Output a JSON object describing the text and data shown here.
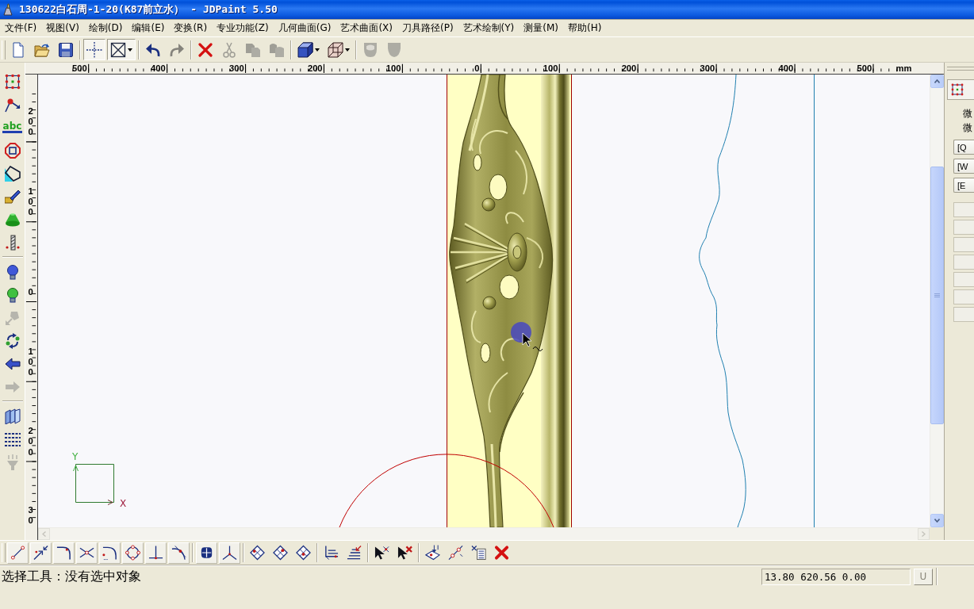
{
  "window": {
    "title": "130622白石周-1-20(K87前立水） - JDPaint 5.50"
  },
  "menu": [
    "文件(F)",
    "视图(V)",
    "绘制(D)",
    "编辑(E)",
    "变换(R)",
    "专业功能(Z)",
    "几何曲面(G)",
    "艺术曲面(X)",
    "刀具路径(P)",
    "艺术绘制(Y)",
    "测量(M)",
    "帮助(H)"
  ],
  "main_toolbar": [
    [
      {
        "kind": "button",
        "pressed": false,
        "disabled": false
      },
      {
        "kind": "button",
        "pressed": false,
        "disabled": false
      },
      {
        "kind": "button",
        "pressed": false,
        "disabled": false
      }
    ],
    [
      {
        "kind": "button",
        "pressed": true,
        "disabled": false
      },
      {
        "kind": "split",
        "pressed": true,
        "disabled": false
      }
    ],
    [
      {
        "kind": "button",
        "pressed": false,
        "disabled": false
      },
      {
        "kind": "button",
        "pressed": false,
        "disabled": true
      }
    ],
    [
      {
        "kind": "button",
        "pressed": false,
        "disabled": false
      },
      {
        "kind": "button",
        "pressed": false,
        "disabled": true
      },
      {
        "kind": "button",
        "pressed": false,
        "disabled": true
      },
      {
        "kind": "button",
        "pressed": false,
        "disabled": true
      }
    ],
    [
      {
        "kind": "split",
        "pressed": false,
        "disabled": false
      },
      {
        "kind": "split",
        "pressed": false,
        "disabled": false
      }
    ],
    [
      {
        "kind": "button",
        "pressed": false,
        "disabled": true
      },
      {
        "kind": "button",
        "pressed": false,
        "disabled": true
      }
    ]
  ],
  "left_toolbar": [
    [
      {
        "disabled": false
      },
      {
        "disabled": false
      },
      {
        "label": "abc",
        "disabled": false
      },
      {
        "disabled": false
      },
      {
        "disabled": false
      },
      {
        "disabled": false
      },
      {
        "disabled": false
      },
      {
        "disabled": false
      }
    ],
    [
      {
        "disabled": false
      },
      {
        "disabled": false
      },
      {
        "disabled": true
      },
      {
        "disabled": false
      },
      {
        "disabled": false
      },
      {
        "disabled": true
      }
    ],
    [
      {
        "disabled": false
      },
      {
        "disabled": false
      },
      {
        "disabled": true
      }
    ]
  ],
  "ruler_top": {
    "labels": [
      "500",
      "400",
      "300",
      "200",
      "100",
      "0",
      "100",
      "200",
      "300",
      "400",
      "500"
    ],
    "unit": "mm"
  },
  "ruler_left": {
    "labels": [
      "200",
      "100",
      "0",
      "100",
      "200",
      "30"
    ]
  },
  "canvas": {
    "axis_labels": {
      "y": "Y",
      "x": "X"
    }
  },
  "right_panel": {
    "labels": [
      "微",
      "微"
    ],
    "buttons": [
      "[Q",
      "[W",
      "[E"
    ]
  },
  "bottom_toolbar": [
    [
      {
        "raised": true
      },
      {
        "raised": true
      },
      {
        "raised": true
      },
      {
        "raised": true
      },
      {
        "raised": true
      },
      {
        "raised": true
      },
      {
        "raised": true
      },
      {
        "raised": true
      }
    ],
    [
      {
        "raised": true
      },
      {
        "raised": true
      }
    ],
    [
      {
        "raised": false
      },
      {
        "raised": false
      },
      {
        "raised": false
      }
    ],
    [
      {
        "raised": false
      },
      {
        "raised": false
      }
    ],
    [
      {
        "raised": false
      },
      {
        "raised": false
      }
    ],
    [
      {
        "raised": false
      },
      {
        "raised": false
      },
      {
        "raised": false
      },
      {
        "raised": false
      }
    ]
  ],
  "status_bar": {
    "message": "选择工具：没有选中对象",
    "coordinates": "13.80 620.56 0.00",
    "button": "U"
  }
}
